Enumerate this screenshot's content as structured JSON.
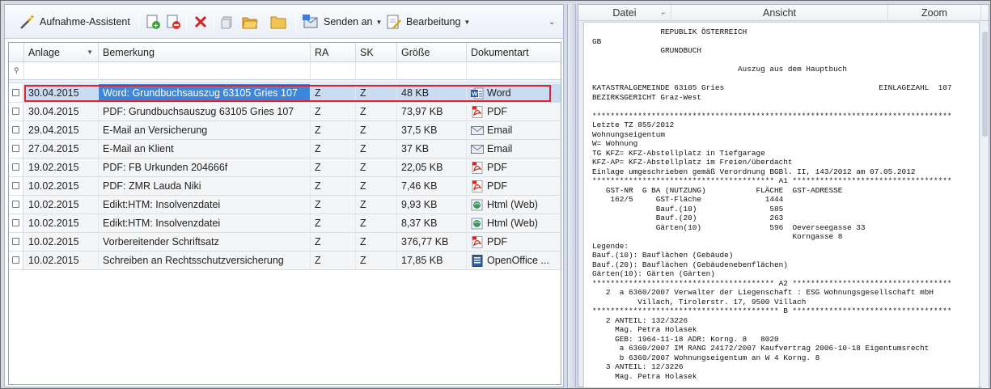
{
  "toolbar": {
    "assistant_label": "Aufnahme-Assistent",
    "send_label": "Senden an",
    "edit_label": "Bearbeitung"
  },
  "grid": {
    "columns": [
      "Anlage",
      "Bemerkung",
      "RA",
      "SK",
      "Größe",
      "Dokumentart"
    ],
    "rows": [
      {
        "anlage": "30.04.2015",
        "bemerkung": "Word: Grundbuchsauszug 63105 Gries 107",
        "ra": "Z",
        "sk": "Z",
        "groesse": "48 KB",
        "typ": "Word",
        "icon": "word-icon",
        "selected": true
      },
      {
        "anlage": "30.04.2015",
        "bemerkung": "PDF: Grundbuchsauszug 63105 Gries 107",
        "ra": "Z",
        "sk": "Z",
        "groesse": "73,97 KB",
        "typ": "PDF",
        "icon": "pdf-icon"
      },
      {
        "anlage": "29.04.2015",
        "bemerkung": "E-Mail an Versicherung",
        "ra": "Z",
        "sk": "Z",
        "groesse": "37,5 KB",
        "typ": "Email",
        "icon": "email-icon"
      },
      {
        "anlage": "27.04.2015",
        "bemerkung": "E-Mail an Klient",
        "ra": "Z",
        "sk": "Z",
        "groesse": "37 KB",
        "typ": "Email",
        "icon": "email-icon"
      },
      {
        "anlage": "19.02.2015",
        "bemerkung": "PDF: FB Urkunden 204666f",
        "ra": "Z",
        "sk": "Z",
        "groesse": "22,05 KB",
        "typ": "PDF",
        "icon": "pdf-icon"
      },
      {
        "anlage": "10.02.2015",
        "bemerkung": "PDF: ZMR Lauda Niki",
        "ra": "Z",
        "sk": "Z",
        "groesse": "7,46 KB",
        "typ": "PDF",
        "icon": "pdf-icon"
      },
      {
        "anlage": "10.02.2015",
        "bemerkung": "Edikt:HTM: Insolvenzdatei",
        "ra": "Z",
        "sk": "Z",
        "groesse": "9,93 KB",
        "typ": "Html (Web)",
        "icon": "html-icon"
      },
      {
        "anlage": "10.02.2015",
        "bemerkung": "Edikt:HTM: Insolvenzdatei",
        "ra": "Z",
        "sk": "Z",
        "groesse": "8,37 KB",
        "typ": "Html (Web)",
        "icon": "html-icon"
      },
      {
        "anlage": "10.02.2015",
        "bemerkung": "Vorbereitender Schriftsatz",
        "ra": "Z",
        "sk": "Z",
        "groesse": "376,77 KB",
        "typ": "PDF",
        "icon": "pdf-icon"
      },
      {
        "anlage": "10.02.2015",
        "bemerkung": "Schreiben an Rechtsschutzversicherung",
        "ra": "Z",
        "sk": "Z",
        "groesse": "17,85 KB",
        "typ": "OpenOffice ...",
        "icon": "openoffice-icon"
      }
    ]
  },
  "viewer": {
    "menu": [
      "Datei",
      "Ansicht",
      "Zoom"
    ],
    "text": "               REPUBLIK ÖSTERREICH\nGB\n               GRUNDBUCH\n\n                                Auszug aus dem Hauptbuch\n\nKATASTRALGEMEINDE 63105 Gries                                  EINLAGEZAHL  107\nBEZIRKSGERICHT Graz-West\n\n*******************************************************************************\nLetzte TZ 855/2012\nWohnungseigentum\nW= Wohnung\nTG KFZ= KFZ-Abstellplatz in Tiefgarage\nKFZ-AP= KFZ-Abstellplatz im Freien/überdacht\nEinlage umgeschrieben gemäß Verordnung BGBl. II, 143/2012 am 07.05.2012\n**************************************** A1 ***********************************\n   GST-NR  G BA (NUTZUNG)           FLÄCHE  GST-ADRESSE\n    162/5     GST-Fläche              1444\n              Bauf.(10)                585\n              Bauf.(20)                263\n              Gärten(10)               596  Oeverseegasse 33\n                                            Korngasse 8\nLegende:\nBauf.(10): Bauflächen (Gebäude)\nBauf.(20): Bauflächen (Gebäudenebenflächen)\nGärten(10): Gärten (Gärten)\n**************************************** A2 ***********************************\n   2  a 6360/2007 Verwalter der Liegenschaft : ESG Wohnungsgesellschaft mbH\n          Villach, Tirolerstr. 17, 9500 Villach\n***************************************** B ***********************************\n   2 ANTEIL: 132/3226\n     Mag. Petra Holasek\n     GEB: 1964-11-18 ADR: Korng. 8   8020\n      a 6360/2007 IM RANG 24172/2007 Kaufvertrag 2006-10-18 Eigentumsrecht\n      b 6360/2007 Wohnungseigentum an W 4 Korng. 8\n   3 ANTEIL: 12/3226\n     Mag. Petra Holasek"
  }
}
